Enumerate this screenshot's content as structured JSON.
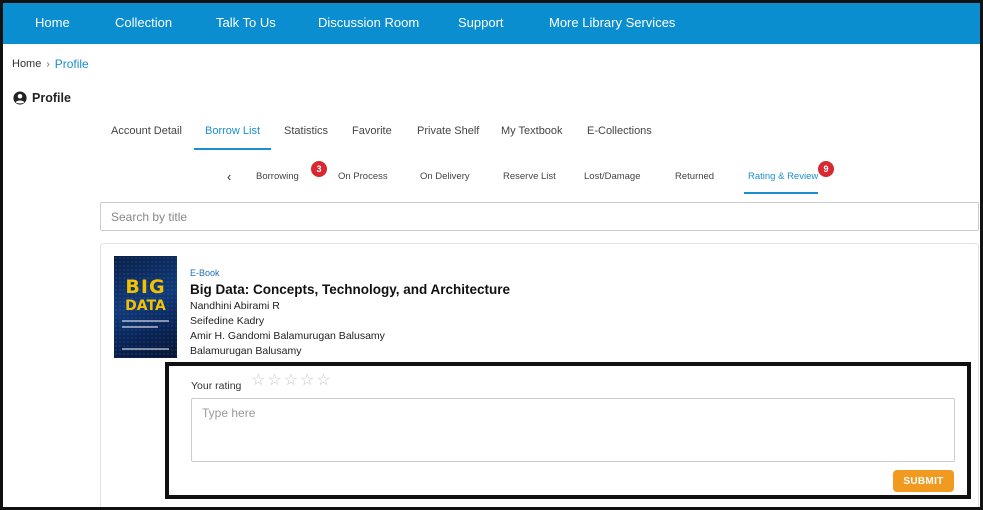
{
  "nav": {
    "items": [
      "Home",
      "Collection",
      "Talk To Us",
      "Discussion Room",
      "Support",
      "More Library Services"
    ]
  },
  "breadcrumb": {
    "home": "Home",
    "separator": "›",
    "current": "Profile"
  },
  "profile": {
    "heading": "Profile",
    "icon": "user-circle-icon"
  },
  "main_tabs": {
    "items": [
      "Account Detail",
      "Borrow List",
      "Statistics",
      "Favorite",
      "Private Shelf",
      "My Textbook",
      "E-Collections"
    ],
    "active": "Borrow List"
  },
  "sub_tabs": {
    "prev_icon": "‹",
    "items": [
      "Borrowing",
      "On Process",
      "On Delivery",
      "Reserve List",
      "Lost/Damage",
      "Returned",
      "Rating & Review"
    ],
    "active": "Rating & Review",
    "badges": {
      "borrowing": "3",
      "rating_review": "9"
    }
  },
  "search": {
    "placeholder": "Search by title",
    "value": ""
  },
  "book": {
    "type": "E-Book",
    "title": "Big Data: Concepts, Technology, and Architecture",
    "authors": [
      "Nandhini Abirami R",
      "Seifedine Kadry",
      "Amir H. Gandomi Balamurugan Balusamy",
      "Balamurugan Balusamy"
    ],
    "cover": {
      "line1": "BIG",
      "line2": "DATA"
    }
  },
  "review": {
    "rating_label": "Your rating",
    "stars": [
      "☆",
      "☆",
      "☆",
      "☆",
      "☆"
    ],
    "rating_value": 0,
    "placeholder": "Type here",
    "submit_label": "SUBMIT"
  },
  "colors": {
    "nav_bg": "#0a8ed0",
    "accent": "#1a8fcf",
    "badge": "#d9282f",
    "submit": "#f29a1f"
  }
}
